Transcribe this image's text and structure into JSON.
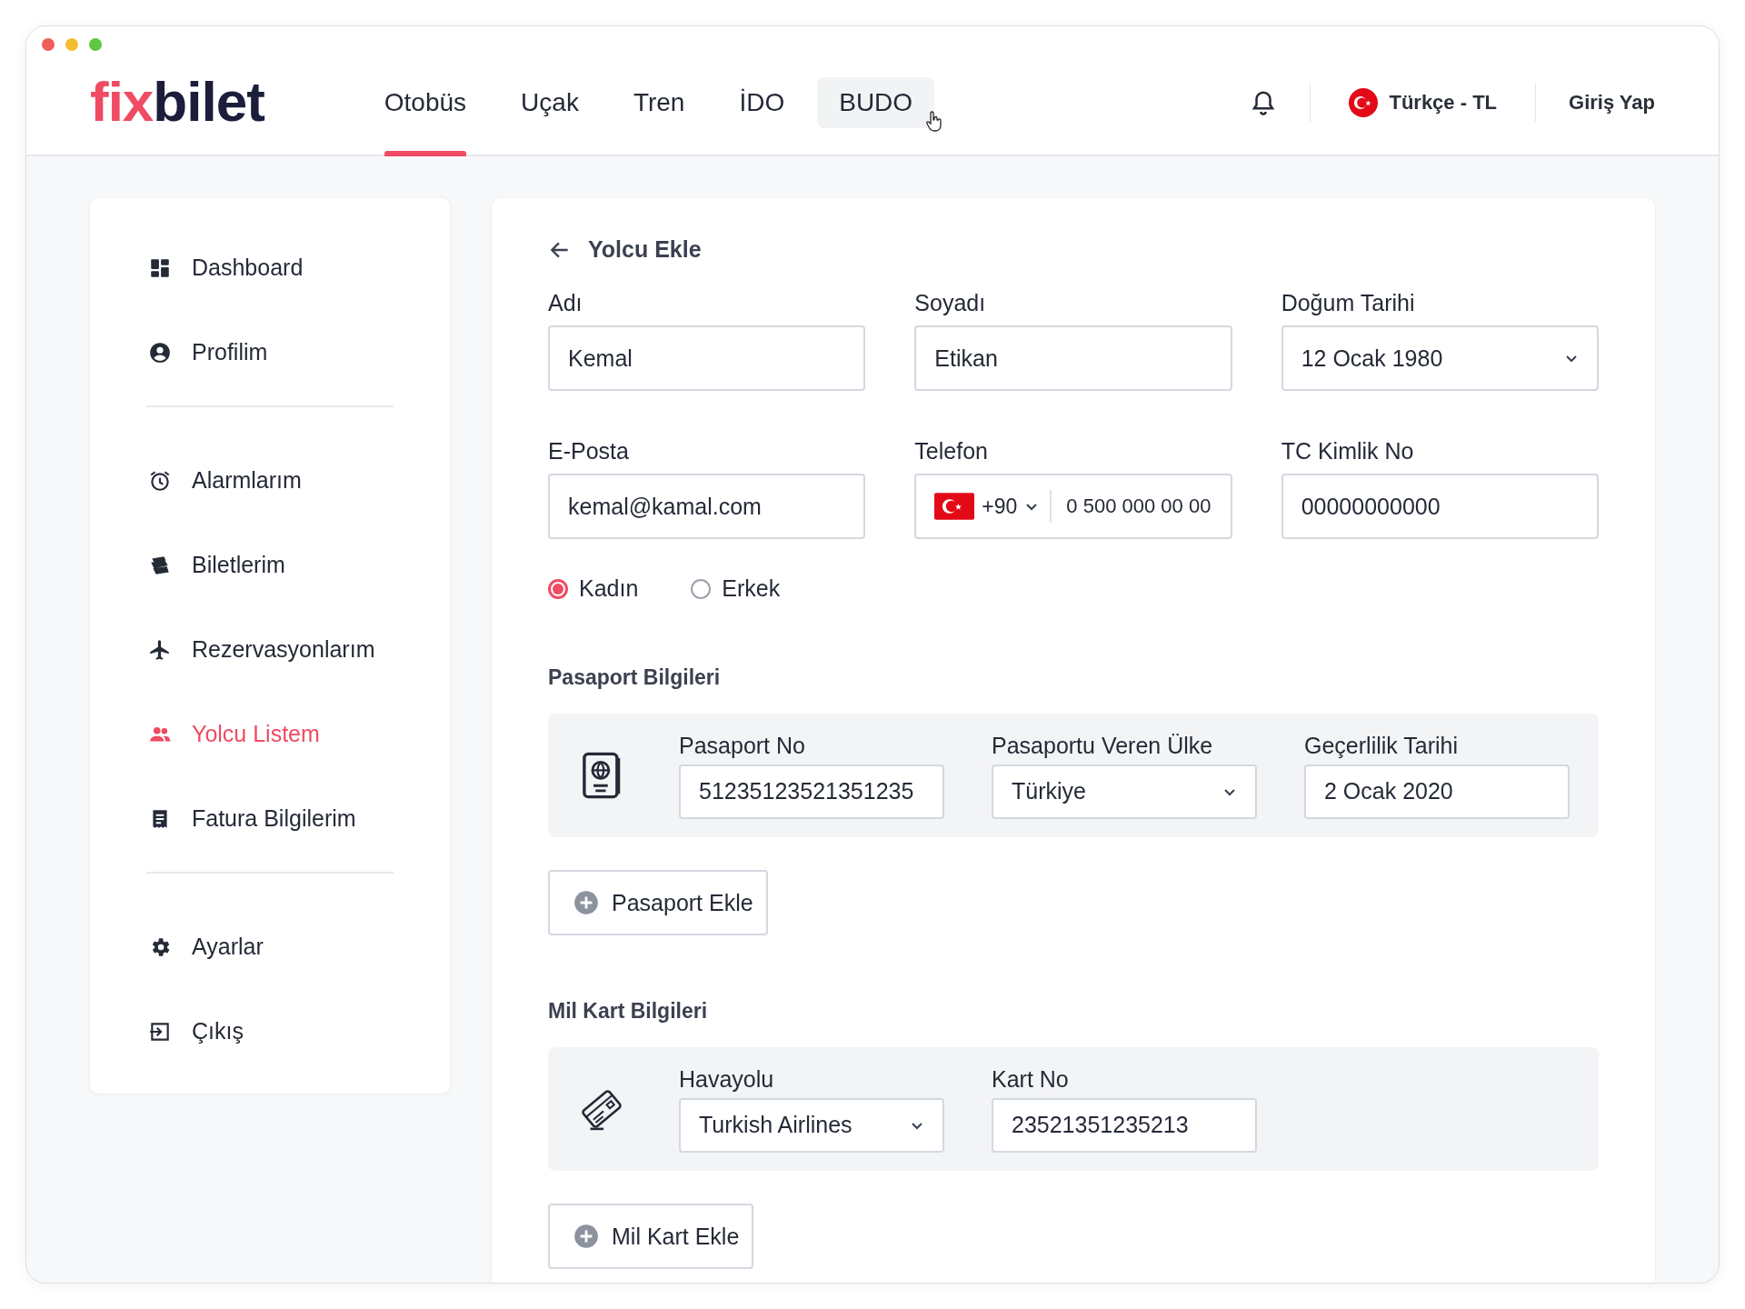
{
  "header": {
    "logo": {
      "accent": "fix",
      "rest": "bilet"
    },
    "nav": [
      {
        "label": "Otobüs",
        "selected": true,
        "hovered": false
      },
      {
        "label": "Uçak",
        "selected": false,
        "hovered": false
      },
      {
        "label": "Tren",
        "selected": false,
        "hovered": false
      },
      {
        "label": "İDO",
        "selected": false,
        "hovered": false
      },
      {
        "label": "BUDO",
        "selected": false,
        "hovered": true
      }
    ],
    "language": "Türkçe - TL",
    "login": "Giriş Yap"
  },
  "sidebar": {
    "groups": [
      [
        {
          "label": "Dashboard",
          "selected": false
        },
        {
          "label": "Profilim",
          "selected": false
        }
      ],
      [
        {
          "label": "Alarmlarım",
          "selected": false
        },
        {
          "label": "Biletlerim",
          "selected": false
        },
        {
          "label": "Rezervasyonlarım",
          "selected": false
        },
        {
          "label": "Yolcu Listem",
          "selected": true
        },
        {
          "label": "Fatura Bilgilerim",
          "selected": false
        }
      ],
      [
        {
          "label": "Ayarlar",
          "selected": false
        },
        {
          "label": "Çıkış",
          "selected": false
        }
      ]
    ]
  },
  "form": {
    "title": "Yolcu Ekle",
    "fields": [
      {
        "kind": "text",
        "label": "Adı",
        "value": "Kemal"
      },
      {
        "kind": "text",
        "label": "Soyadı",
        "value": "Etikan"
      },
      {
        "kind": "select",
        "label": "Doğum Tarihi",
        "value": "12 Ocak 1980"
      },
      {
        "kind": "text",
        "label": "E-Posta",
        "value": "kemal@kamal.com"
      },
      {
        "kind": "phone",
        "label": "Telefon",
        "code": "+90",
        "value": "0 500 000 00 00"
      },
      {
        "kind": "text",
        "label": "TC Kimlik No",
        "value": "00000000000"
      }
    ],
    "gender": [
      {
        "label": "Kadın",
        "selected": true
      },
      {
        "label": "Erkek",
        "selected": false
      }
    ],
    "sections": [
      {
        "kind": "passport",
        "title": "Pasaport Bilgileri",
        "fields": [
          {
            "kind": "text",
            "label": "Pasaport No",
            "value": "51235123521351235"
          },
          {
            "kind": "select",
            "label": "Pasaportu Veren Ülke",
            "value": "Türkiye"
          },
          {
            "kind": "text",
            "label": "Geçerlilik Tarihi",
            "value": "2 Ocak 2020"
          }
        ],
        "add_button": "Pasaport Ekle"
      },
      {
        "kind": "card",
        "title": "Mil Kart Bilgileri",
        "fields": [
          {
            "kind": "select",
            "label": "Havayolu",
            "value": "Turkish Airlines"
          },
          {
            "kind": "text",
            "label": "Kart No",
            "value": "23521351235213"
          }
        ],
        "add_button": "Mil Kart Ekle"
      }
    ]
  }
}
